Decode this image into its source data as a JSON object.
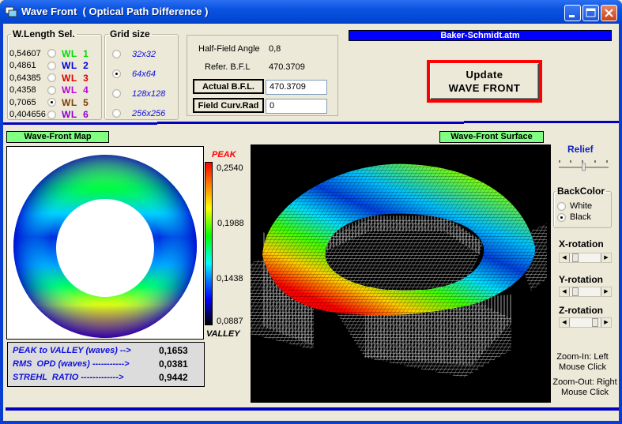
{
  "window": {
    "title": "Wave Front  ( Optical Path Difference )",
    "controls": [
      "minimize",
      "maximize",
      "close"
    ]
  },
  "wavelength_group": {
    "title": "W.Length Sel.",
    "items": [
      {
        "value": "0,54607",
        "label": "WL  1",
        "color": "#00e000",
        "selected": false
      },
      {
        "value": "0,4861",
        "label": "WL  2",
        "color": "#0000e0",
        "selected": false
      },
      {
        "value": "0,64385",
        "label": "WL  3",
        "color": "#e00000",
        "selected": false
      },
      {
        "value": "0,4358",
        "label": "WL  4",
        "color": "#c000e0",
        "selected": false
      },
      {
        "value": "0,7065",
        "label": "WL  5",
        "color": "#804000",
        "selected": true
      },
      {
        "value": "0,404656",
        "label": "WL  6",
        "color": "#9000d0",
        "selected": false
      }
    ]
  },
  "grid_group": {
    "title": "Grid size",
    "options": [
      {
        "label": "32x32",
        "selected": false
      },
      {
        "label": "64x64",
        "selected": true
      },
      {
        "label": "128x128",
        "selected": false
      },
      {
        "label": "256x256",
        "selected": false
      }
    ]
  },
  "info": {
    "half_field_label": "Half-Field Angle",
    "half_field_value": "0,8",
    "ref_bfl_label": "Refer. B.F.L",
    "ref_bfl_value": "470.3709",
    "actual_bfl_label": "Actual B.F.L.",
    "actual_bfl_value": "470.3709",
    "field_curv_label": "Field Curv.Rad",
    "field_curv_value": "0"
  },
  "file": {
    "name": "Baker-Schmidt.atm"
  },
  "update_button": {
    "line1": "Update",
    "line2": "WAVE FRONT"
  },
  "map": {
    "title": "Wave-Front  Map",
    "scale": {
      "peak_label": "PEAK",
      "valley_label": "VALLEY",
      "ticks": [
        "0,2540",
        "0,1988",
        "0,1438",
        "0,0887"
      ]
    }
  },
  "stats": {
    "rows": [
      {
        "label": "PEAK to VALLEY (waves) -->",
        "value": "0,1653"
      },
      {
        "label": "RMS  OPD (waves) ----------->",
        "value": "0,0381"
      },
      {
        "label": "STREHL  RATIO ------------->",
        "value": "0,9442"
      }
    ]
  },
  "surface": {
    "title": "Wave-Front Surface"
  },
  "controls": {
    "relief_label": "Relief",
    "relief_position": 0.5,
    "backcolor_title": "BackColor",
    "backcolor_options": [
      {
        "label": "White",
        "selected": false
      },
      {
        "label": "Black",
        "selected": true
      }
    ],
    "x_rotation_label": "X-rotation",
    "x_rotation_position": 0.1,
    "y_rotation_label": "Y-rotation",
    "y_rotation_position": 0.1,
    "z_rotation_label": "Z-rotation",
    "z_rotation_position": 0.9,
    "zoom_in_text_1": "Zoom-In: Left",
    "zoom_in_text_2": "Mouse  Click",
    "zoom_out_text_1": "Zoom-Out: Right",
    "zoom_out_text_2": "Mouse  Click"
  }
}
